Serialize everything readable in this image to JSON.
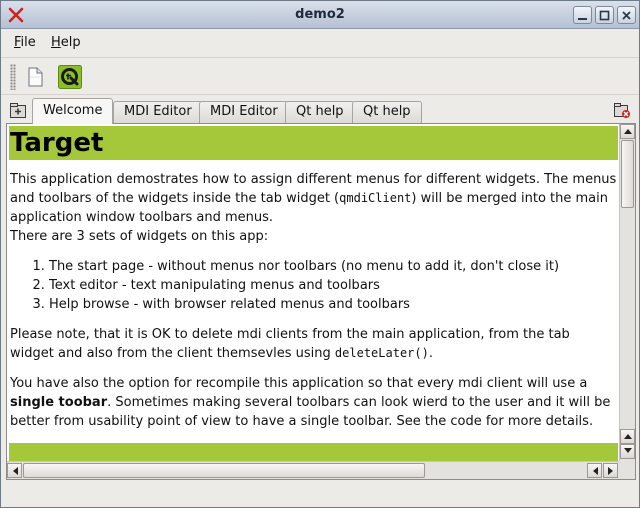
{
  "window": {
    "title": "demo2"
  },
  "menubar": {
    "file": {
      "mnemonic": "F",
      "rest": "ile"
    },
    "help": {
      "mnemonic": "H",
      "rest": "elp"
    }
  },
  "toolbar": {
    "items": [
      "new-document-icon",
      "qt-logo-icon"
    ]
  },
  "tabs": [
    {
      "label": "Welcome",
      "active": true
    },
    {
      "label": "MDI Editor"
    },
    {
      "label": "MDI Editor"
    },
    {
      "label": "Qt help"
    },
    {
      "label": "Qt help"
    }
  ],
  "content": {
    "heading": "Target",
    "intro_1": "This application demostrates how to assign different menus for different widgets. The menus and toolbars of the widgets inside the tab widget (",
    "intro_code": "qmdiClient",
    "intro_2": ") will be merged into the main application window toolbars and menus.",
    "sets_line": "There are 3 sets of widgets on this app:",
    "list": [
      "The start page - without menus nor toolbars (no menu to add it, don't close it)",
      "Text editor - text manipulating menus and toolbars",
      "Help browse - with browser related menus and toolbars"
    ],
    "note_1": " Please note, that it is OK to delete mdi clients from the main application, from the tab widget and also from the client themsevles using ",
    "note_code": "deleteLater()",
    "note_2": ".",
    "option_1": "You have also the option for recompile this application so that every mdi client will use a ",
    "option_bold": "single toobar",
    "option_2": ". Sometimes making several toolbars can look wierd to the user and it will be better from usability point of view to have a single toolbar. See the code for more details."
  },
  "colors": {
    "heading_bg": "#a5c83a",
    "titlebar_top": "#d8e0ea",
    "titlebar_bottom": "#b5c2d3",
    "close_x": "#d02020"
  }
}
